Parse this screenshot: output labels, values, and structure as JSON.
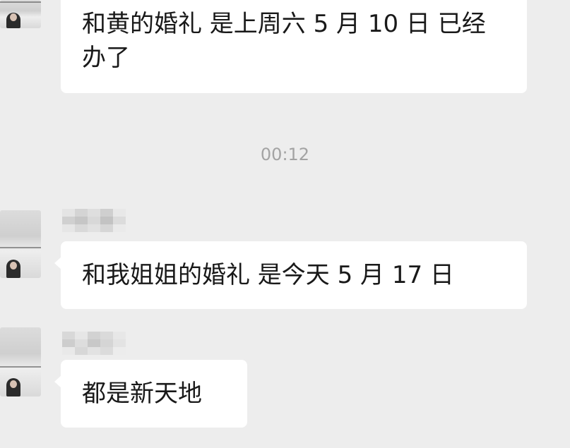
{
  "chat": {
    "messages": [
      {
        "text": "和黄的婚礼 是上周六 5 月 10 日 已经办了"
      },
      {
        "text": "和我姐姐的婚礼 是今天 5 月 17 日"
      },
      {
        "text": "都是新天地"
      }
    ],
    "timestamp": "00:12"
  },
  "colors": {
    "background": "#ededed",
    "bubble": "#ffffff",
    "text": "#191919",
    "timestamp": "#a3a3a3"
  }
}
